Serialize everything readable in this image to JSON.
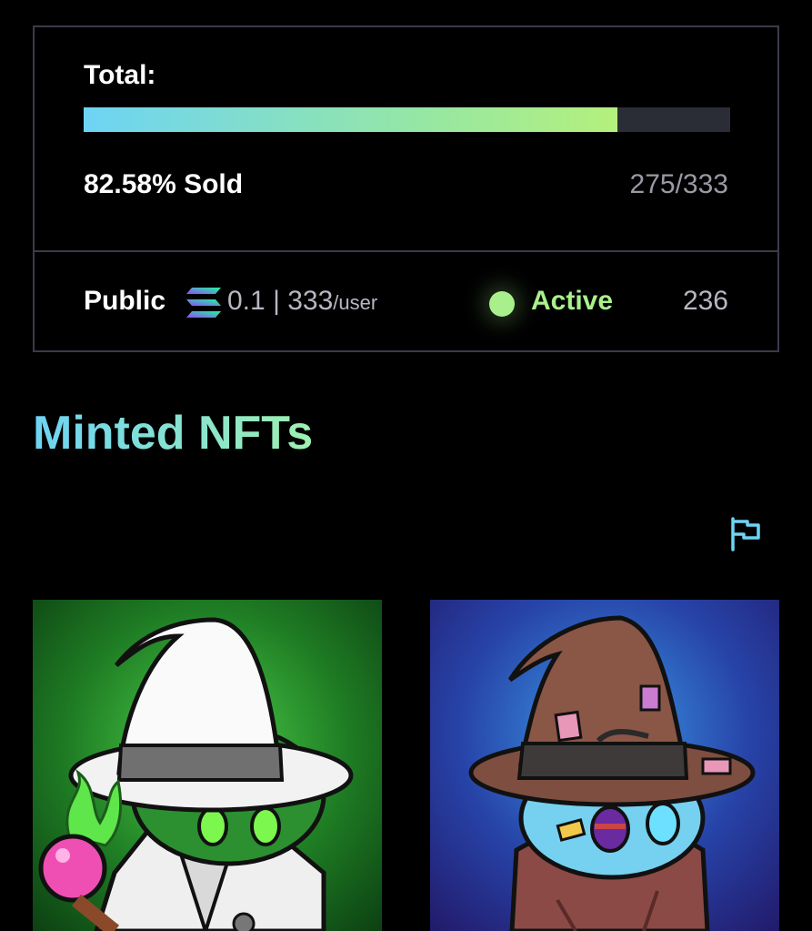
{
  "mint": {
    "total_label": "Total:",
    "progress_fraction": 0.8258,
    "sold_label": "82.58% Sold",
    "sold_count": "275/333",
    "phase": {
      "name": "Public",
      "currency_icon": "solana-icon",
      "price": "0.1",
      "separator": "|",
      "limit": "333",
      "limit_unit": "/user",
      "status": "Active",
      "count": "236"
    }
  },
  "minted": {
    "title": "Minted NFTs",
    "report_icon": "flag-icon",
    "items": [
      {
        "icon": "white-wizard-nft-image"
      },
      {
        "icon": "brown-wizard-nft-image"
      }
    ]
  },
  "colors": {
    "background": "#000000",
    "border": "#3b3b4a",
    "accent_blue": "#6dd4f4",
    "accent_green": "#a9f08c",
    "muted_text": "#9a9aa6"
  }
}
